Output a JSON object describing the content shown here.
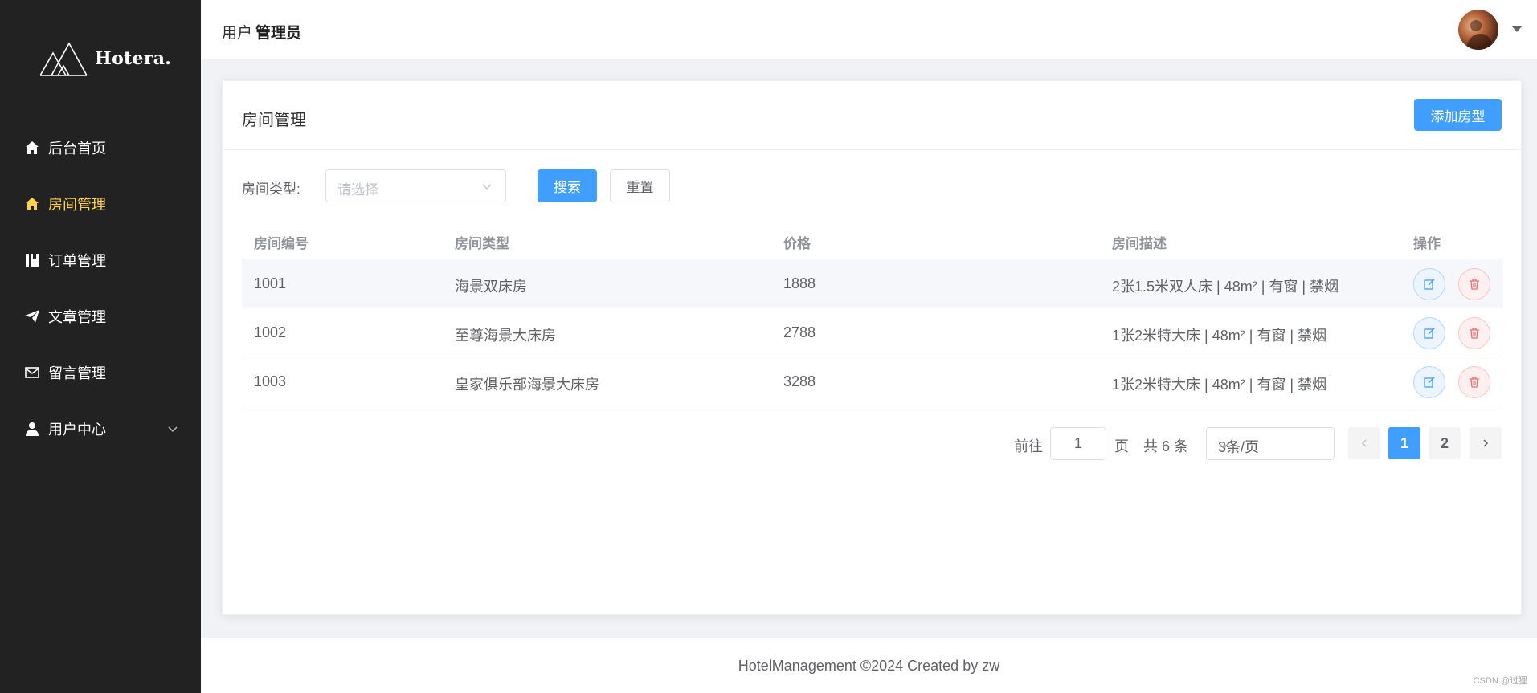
{
  "app": {
    "logo_text": "Hotera.",
    "header_user_prefix": "用户",
    "header_user_role": "管理员"
  },
  "sidebar": {
    "items": [
      {
        "label": "后台首页",
        "icon": "home-icon"
      },
      {
        "label": "房间管理",
        "icon": "home-icon",
        "active": true
      },
      {
        "label": "订单管理",
        "icon": "book-icon"
      },
      {
        "label": "文章管理",
        "icon": "paper-plane-icon"
      },
      {
        "label": "留言管理",
        "icon": "mail-icon"
      },
      {
        "label": "用户中心",
        "icon": "user-icon",
        "expandable": true
      }
    ]
  },
  "card": {
    "title": "房间管理",
    "add_button": "添加房型"
  },
  "filter": {
    "label": "房间类型:",
    "placeholder": "请选择",
    "search_button": "搜索",
    "reset_button": "重置"
  },
  "table": {
    "headers": [
      "房间编号",
      "房间类型",
      "价格",
      "房间描述",
      "操作"
    ],
    "rows": [
      {
        "id": "1001",
        "type": "海景双床房",
        "price": "1888",
        "desc": "2张1.5米双人床 | 48m² | 有窗 | 禁烟"
      },
      {
        "id": "1002",
        "type": "至尊海景大床房",
        "price": "2788",
        "desc": "1张2米特大床 | 48m² | 有窗 | 禁烟"
      },
      {
        "id": "1003",
        "type": "皇家俱乐部海景大床房",
        "price": "3288",
        "desc": "1张2米特大床 | 48m² | 有窗 | 禁烟"
      }
    ]
  },
  "pagination": {
    "goto_prefix": "前往",
    "goto_value": "1",
    "goto_suffix": "页",
    "total": "共 6 条",
    "page_size": "3条/页",
    "pages": [
      "1",
      "2"
    ],
    "current_page": "1"
  },
  "footer": {
    "text": "HotelManagement ©2024 Created by zw",
    "watermark": "CSDN @过狸"
  },
  "colors": {
    "sidebar_bg": "#222222",
    "active": "#ffd04b",
    "primary": "#409eff",
    "danger": "#f56c6c"
  }
}
